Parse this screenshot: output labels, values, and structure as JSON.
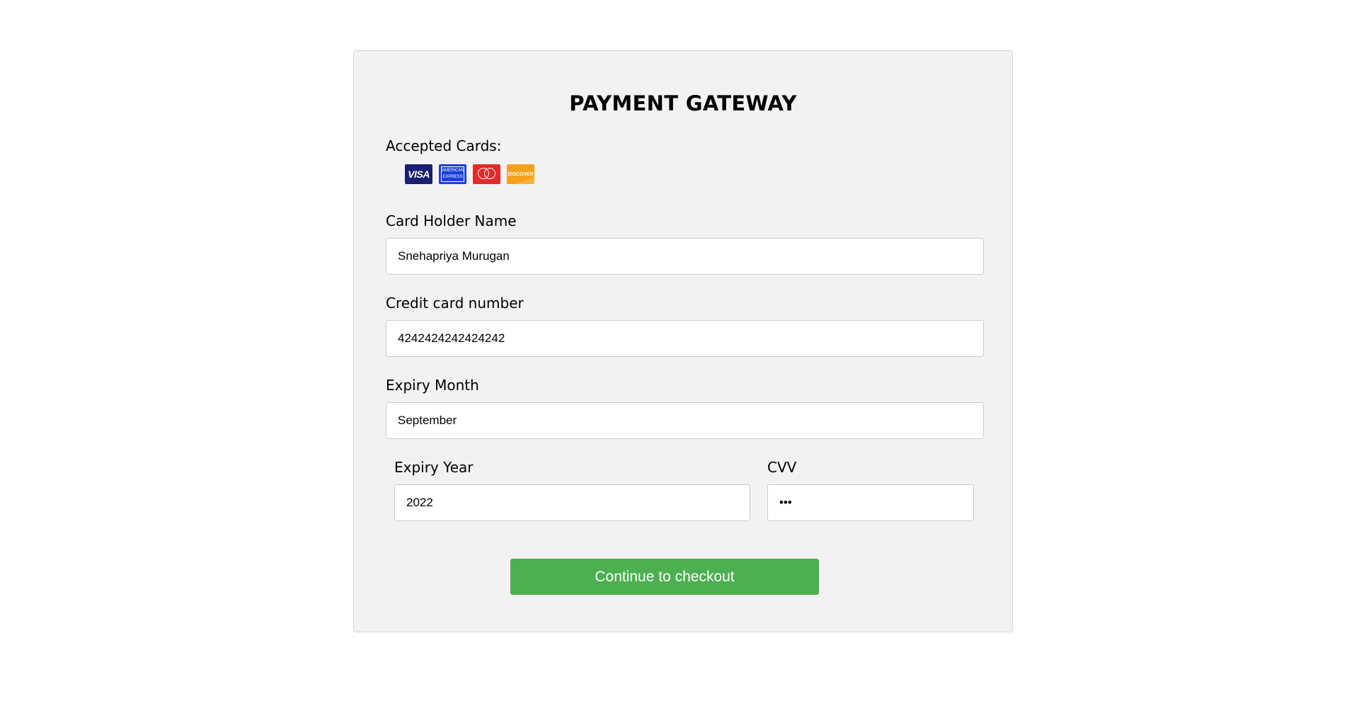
{
  "form": {
    "title": "PAYMENT GATEWAY",
    "accepted_cards_label": "Accepted Cards:",
    "cards": [
      {
        "name": "visa",
        "text": "VISA",
        "color": "#1a1f71"
      },
      {
        "name": "american-express",
        "text": "AMERICAN EXPRESS",
        "color": "#1c3fd9"
      },
      {
        "name": "mastercard",
        "text": "",
        "color": "#e12a2a"
      },
      {
        "name": "discover",
        "text": "DISCOVER",
        "color": "#f7a11a"
      }
    ],
    "card_holder": {
      "label": "Card Holder Name",
      "value": "Snehapriya Murugan"
    },
    "card_number": {
      "label": "Credit card number",
      "value": "4242424242424242"
    },
    "expiry_month": {
      "label": "Expiry Month",
      "value": "September"
    },
    "expiry_year": {
      "label": "Expiry Year",
      "value": "2022"
    },
    "cvv": {
      "label": "CVV",
      "value": "•••"
    },
    "submit_label": "Continue to checkout",
    "accent_color": "#4caf50",
    "panel_color": "#f2f2f2"
  }
}
